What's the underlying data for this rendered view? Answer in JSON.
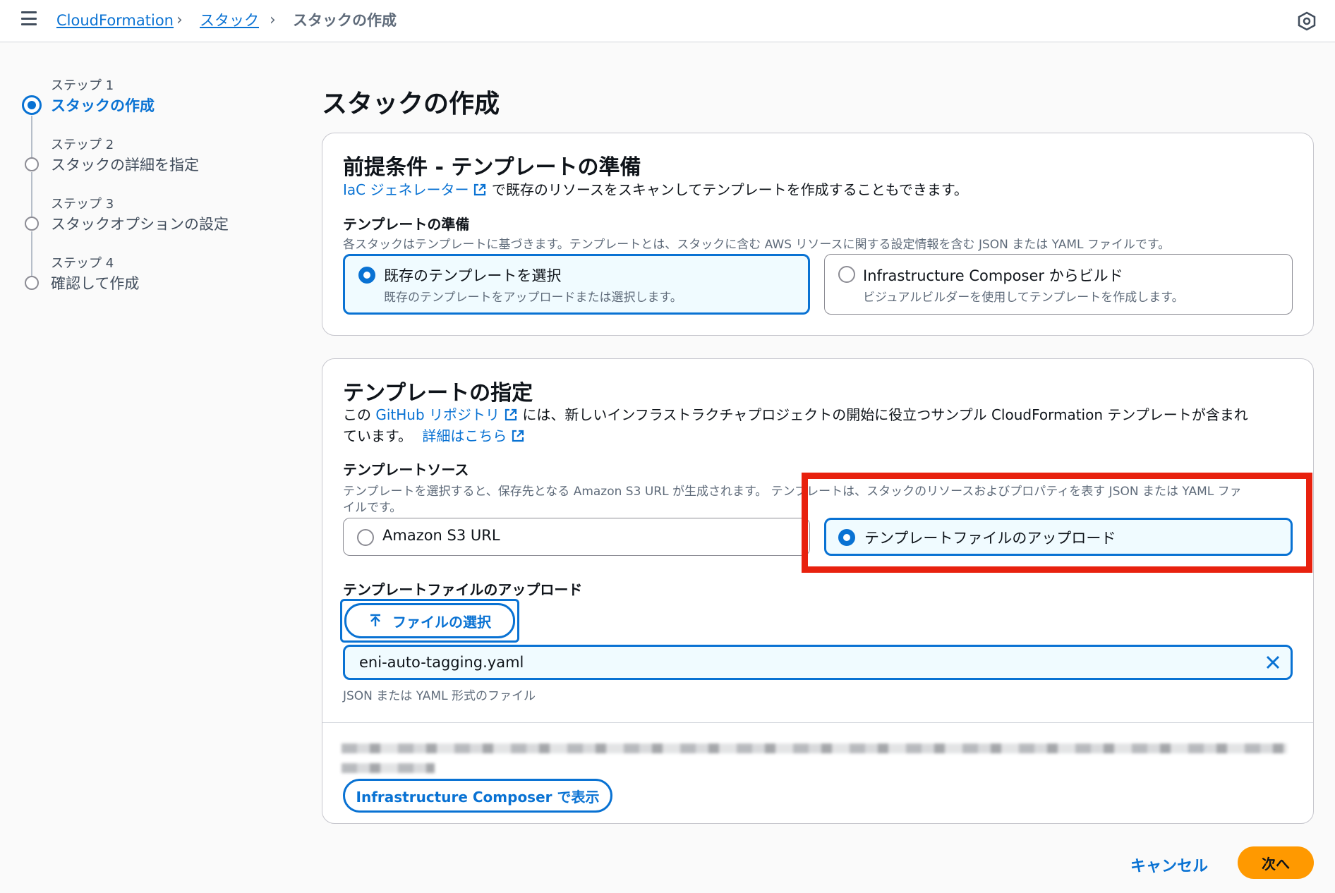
{
  "breadcrumb": {
    "items": [
      "CloudFormation",
      "スタック"
    ],
    "current": "スタックの作成"
  },
  "steps": [
    {
      "num": "ステップ 1",
      "label": "スタックの作成"
    },
    {
      "num": "ステップ 2",
      "label": "スタックの詳細を指定"
    },
    {
      "num": "ステップ 3",
      "label": "スタックオプションの設定"
    },
    {
      "num": "ステップ 4",
      "label": "確認して作成"
    }
  ],
  "page_title": "スタックの作成",
  "prereq": {
    "title": "前提条件 - テンプレートの準備",
    "iac_link": "IaC ジェネレーター",
    "iac_text": "で既存のリソースをスキャンしてテンプレートを作成することもできます。",
    "prepare_label": "テンプレートの準備",
    "prepare_desc": "各スタックはテンプレートに基づきます。テンプレートとは、スタックに含む AWS リソースに関する設定情報を含む JSON または YAML ファイルです。",
    "options": [
      {
        "title": "既存のテンプレートを選択",
        "desc": "既存のテンプレートをアップロードまたは選択します。"
      },
      {
        "title": "Infrastructure Composer からビルド",
        "desc": "ビジュアルビルダーを使用してテンプレートを作成します。"
      }
    ]
  },
  "spec": {
    "title": "テンプレートの指定",
    "text_pre": "この",
    "github_link": "GitHub リポジトリ",
    "text_post": "には、新しいインフラストラクチャプロジェクトの開始に役立つサンプル CloudFormation テンプレートが含まれ",
    "text_line2": "ています。",
    "details_link": "詳細はこちら",
    "source_label": "テンプレートソース",
    "source_desc_1": "テンプレートを選択すると、保存先となる Amazon S3 URL が生成されます。 テンプレートは、スタックのリソースおよびプロパティを表す JSON または YAML ファ",
    "source_desc_2": "イルです。",
    "sources": [
      "Amazon S3 URL",
      "テンプレートファイルのアップロード"
    ],
    "upload_label": "テンプレートファイルのアップロード",
    "choose_file_label": "ファイルの選択",
    "file_name": "eni-auto-tagging.yaml",
    "file_hint": "JSON または YAML 形式のファイル",
    "composer_button": "Infrastructure Composer で表示"
  },
  "footer": {
    "cancel": "キャンセル",
    "next": "次へ"
  },
  "colors": {
    "accent": "#0972d3",
    "primary_button": "#ff9900",
    "highlight": "#e8210e"
  }
}
